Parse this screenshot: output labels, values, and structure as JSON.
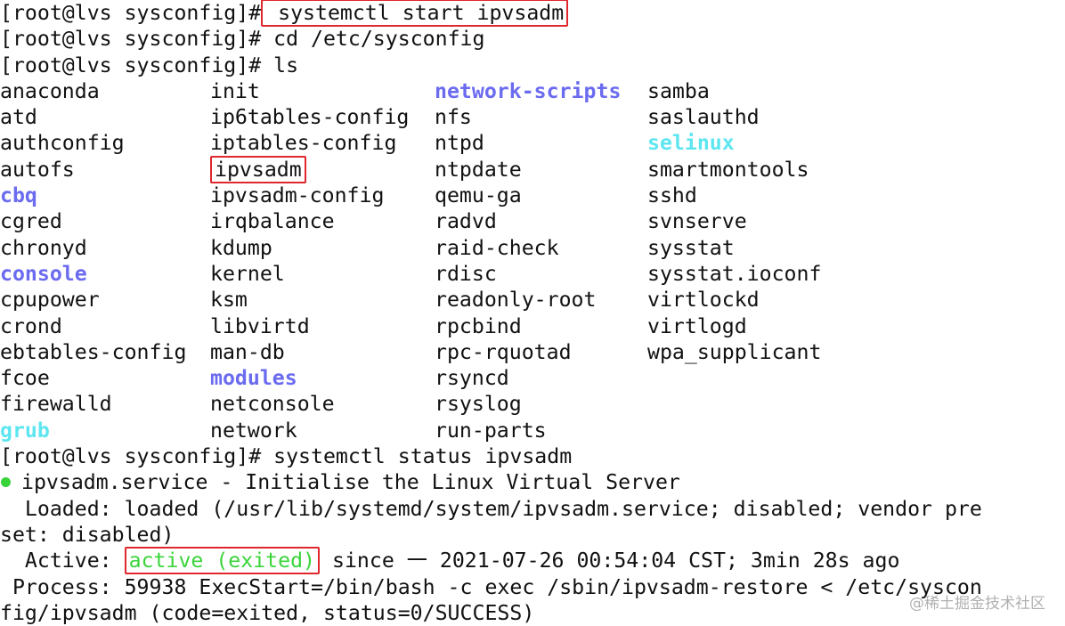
{
  "terminal": {
    "prompt": "[root@lvs sysconfig]#",
    "cmd1": " systemctl start ipvsadm",
    "cmd2": " cd /etc/sysconfig",
    "cmd3": " ls",
    "ls_rows": [
      [
        "anaconda",
        "init",
        "network-scripts",
        "samba"
      ],
      [
        "atd",
        "ip6tables-config",
        "nfs",
        "saslauthd"
      ],
      [
        "authconfig",
        "iptables-config",
        "ntpd",
        "selinux"
      ],
      [
        "autofs",
        "ipvsadm",
        "ntpdate",
        "smartmontools"
      ],
      [
        "cbq",
        "ipvsadm-config",
        "qemu-ga",
        "sshd"
      ],
      [
        "cgred",
        "irqbalance",
        "radvd",
        "svnserve"
      ],
      [
        "chronyd",
        "kdump",
        "raid-check",
        "sysstat"
      ],
      [
        "console",
        "kernel",
        "rdisc",
        "sysstat.ioconf"
      ],
      [
        "cpupower",
        "ksm",
        "readonly-root",
        "virtlockd"
      ],
      [
        "crond",
        "libvirtd",
        "rpcbind",
        "virtlogd"
      ],
      [
        "ebtables-config",
        "man-db",
        "rpc-rquotad",
        "wpa_supplicant"
      ],
      [
        "fcoe",
        "modules",
        "rsyncd",
        ""
      ],
      [
        "firewalld",
        "netconsole",
        "rsyslog",
        ""
      ],
      [
        "grub",
        "network",
        "run-parts",
        ""
      ]
    ],
    "cmd4": " systemctl status ipvsadm",
    "status": {
      "service_line": "ipvsadm.service - Initialise the Linux Virtual Server",
      "loaded_line1": "  Loaded: loaded (/usr/lib/systemd/system/ipvsadm.service; disabled; vendor pre",
      "loaded_line2": "set: disabled)",
      "active_label": "  Active:",
      "active_value": "active (exited)",
      "active_rest": "since 一 2021-07-26 00:54:04 CST; 3min 28s ago",
      "process_line1": " Process: 59938 ExecStart=/bin/bash -c exec /sbin/ipvsadm-restore < /etc/syscon",
      "process_line2": "fig/ipvsadm (code=exited, status=0/SUCCESS)"
    }
  },
  "watermark": "@稀土掘金技术社区",
  "colors": {
    "directory": "#6b6bf0",
    "symlink": "#5ee6f0",
    "active": "#3ad43a",
    "highlight_box": "#e0272e"
  }
}
